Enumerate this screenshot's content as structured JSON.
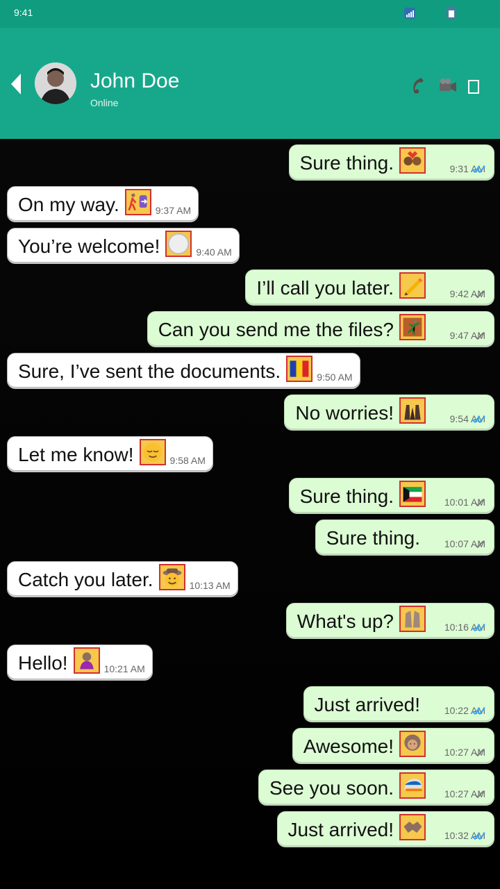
{
  "status_bar": {
    "time": "9:41"
  },
  "header": {
    "contact_name": "John Doe",
    "contact_status": "Online"
  },
  "colors": {
    "header": "#17a88b",
    "status_bar": "#0f9c7f",
    "outgoing_bubble": "#dcfcd4",
    "incoming_bubble": "#ffffff",
    "read_tick": "#32a8ff",
    "sent_tick": "#7b7b7b"
  },
  "messages": [
    {
      "text": "Sure thing.",
      "time": "9:31 AM",
      "direction": "outgoing",
      "status": "read",
      "emoji": "couple-with-heart"
    },
    {
      "text": "On my way.",
      "time": "9:37 AM",
      "direction": "incoming",
      "emoji": "person-walking-right"
    },
    {
      "text": "You’re welcome!",
      "time": "9:40 AM",
      "direction": "incoming",
      "emoji": "white-circle"
    },
    {
      "text": "I’ll call you later.",
      "time": "9:42 AM",
      "direction": "outgoing",
      "status": "sent",
      "emoji": "pencil"
    },
    {
      "text": "Can you send me the files?",
      "time": "9:47 AM",
      "direction": "outgoing",
      "status": "sent",
      "emoji": "person-climbing"
    },
    {
      "text": "Sure, I’ve sent the documents.",
      "time": "9:50 AM",
      "direction": "incoming",
      "emoji": "flag-romania"
    },
    {
      "text": "No worries!",
      "time": "9:54 AM",
      "direction": "outgoing",
      "status": "read",
      "emoji": "palms-up-together"
    },
    {
      "text": "Let me know!",
      "time": "9:58 AM",
      "direction": "incoming",
      "emoji": "relieved-face"
    },
    {
      "text": "Sure thing.",
      "time": "10:01 AM",
      "direction": "outgoing",
      "status": "sent",
      "emoji": "flag-kuwait"
    },
    {
      "text": "Sure thing.",
      "time": "10:07 AM",
      "direction": "outgoing",
      "status": "sent",
      "emoji": ""
    },
    {
      "text": "Catch you later.",
      "time": "10:13 AM",
      "direction": "incoming",
      "emoji": "cowboy-face"
    },
    {
      "text": "What's up?",
      "time": "10:16 AM",
      "direction": "outgoing",
      "status": "read",
      "emoji": "raised-hands"
    },
    {
      "text": "Hello!",
      "time": "10:21 AM",
      "direction": "incoming",
      "emoji": "person-bowing"
    },
    {
      "text": "Just arrived!",
      "time": "10:22 AM",
      "direction": "outgoing",
      "status": "read",
      "emoji": ""
    },
    {
      "text": "Awesome!",
      "time": "10:27 AM",
      "direction": "outgoing",
      "status": "sent",
      "emoji": "woman"
    },
    {
      "text": "See you soon.",
      "time": "10:27 AM",
      "direction": "outgoing",
      "status": "sent",
      "emoji": "high-speed-train"
    },
    {
      "text": "Just arrived!",
      "time": "10:32 AM",
      "direction": "outgoing",
      "status": "read",
      "emoji": "handshake"
    }
  ]
}
